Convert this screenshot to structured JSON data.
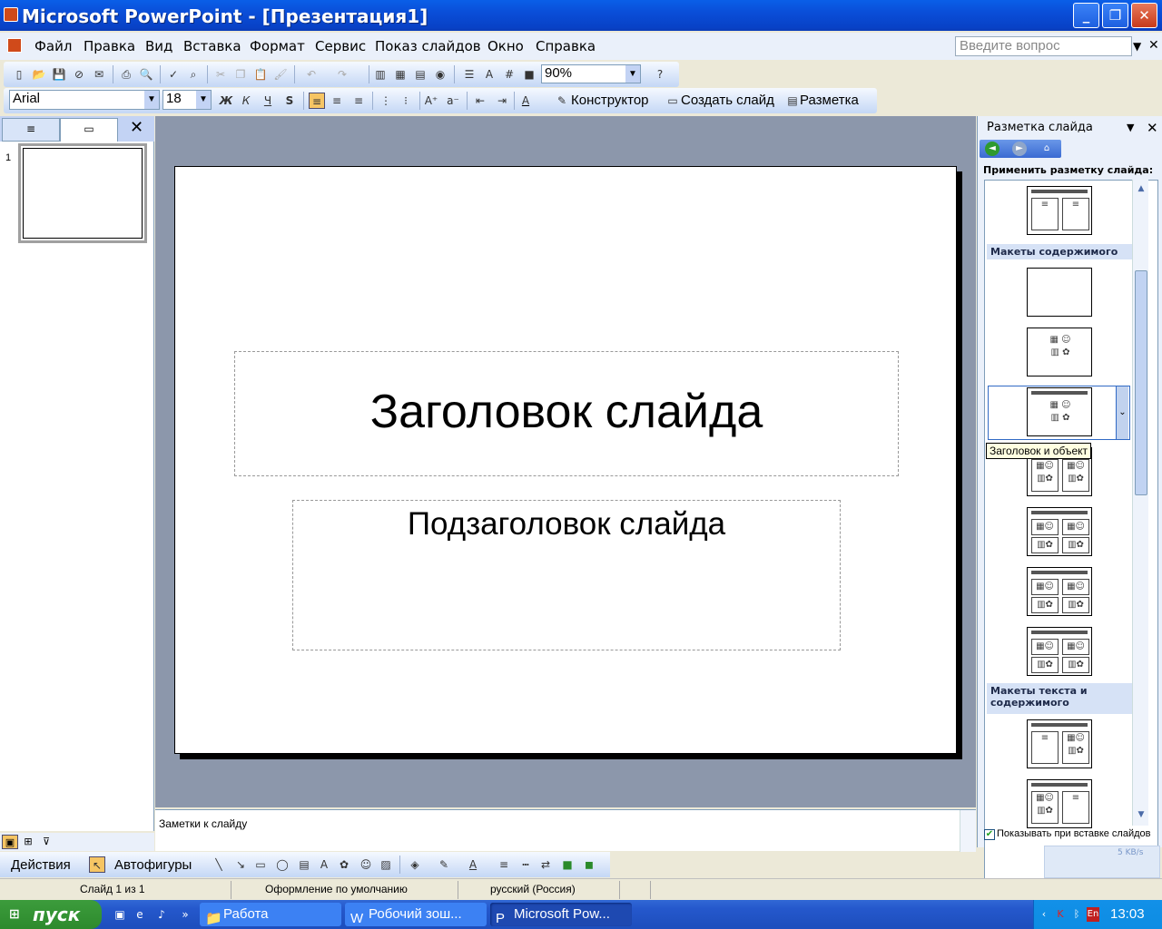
{
  "window": {
    "title": "Microsoft PowerPoint - [Презентация1]",
    "minimize": "_",
    "maximize": "❐",
    "close": "✕"
  },
  "menu": {
    "items": [
      "Файл",
      "Правка",
      "Вид",
      "Вставка",
      "Формат",
      "Сервис",
      "Показ слайдов",
      "Окно",
      "Справка"
    ],
    "ask_placeholder": "Введите вопрос"
  },
  "toolbar": {
    "zoom": "90%",
    "font_name": "Arial",
    "font_size": "18",
    "bold": "Ж",
    "italic": "К",
    "underline": "Ч",
    "shadow": "S",
    "designer": "Конструктор",
    "new_slide": "Создать слайд",
    "layout": "Разметка"
  },
  "slides_pane": {
    "slide_number": "1"
  },
  "slide": {
    "title": "Заголовок слайда",
    "subtitle": "Подзаголовок слайда"
  },
  "notes": {
    "placeholder": "Заметки к слайду"
  },
  "task_pane": {
    "title": "Разметка слайда",
    "apply_label": "Применить разметку слайда:",
    "section_content": "Макеты содержимого",
    "section_text_content": "Макеты текста и содержимого",
    "tooltip": "Заголовок и объект",
    "show_on_insert": "Показывать при вставке слайдов",
    "show_on_insert_checked": true
  },
  "drawing": {
    "actions": "Действия",
    "autoshapes": "Автофигуры"
  },
  "status": {
    "slide": "Слайд 1 из 1",
    "design": "Оформление по умолчанию",
    "language": "русский (Россия)",
    "net_speed": "5 KB/s"
  },
  "taskbar": {
    "start": "пуск",
    "buttons": [
      "Работа",
      "Робочий зош...",
      "Microsoft Pow..."
    ],
    "lang": "En",
    "clock": "13:03"
  }
}
